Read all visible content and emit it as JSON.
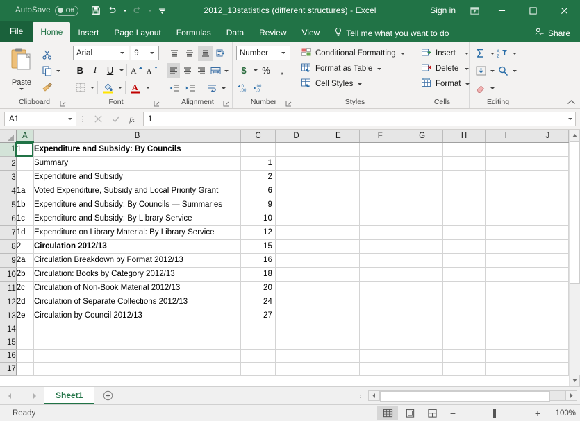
{
  "titlebar": {
    "autosave_label": "AutoSave",
    "autosave_state": "Off",
    "save_icon": "save-icon",
    "undo_icon": "undo-icon",
    "redo_icon": "redo-icon",
    "customize_icon": "customize-quick-access-toolbar-icon",
    "document_title": "2012_13statistics (different structures)  -  Excel",
    "signin_label": "Sign in",
    "ribbon_display_icon": "ribbon-display-options-icon",
    "minimize_icon": "minimize-icon",
    "maximize_icon": "maximize-icon",
    "close_icon": "close-icon"
  },
  "ribbon_tabs": {
    "file": "File",
    "items": [
      {
        "label": "Home",
        "active": true
      },
      {
        "label": "Insert",
        "active": false
      },
      {
        "label": "Page Layout",
        "active": false
      },
      {
        "label": "Formulas",
        "active": false
      },
      {
        "label": "Data",
        "active": false
      },
      {
        "label": "Review",
        "active": false
      },
      {
        "label": "View",
        "active": false
      }
    ],
    "tellme": "Tell me what you want to do",
    "tellme_icon": "lightbulb-icon",
    "share": "Share",
    "share_icon": "share-person-icon"
  },
  "ribbon": {
    "clipboard": {
      "group_label": "Clipboard",
      "paste_label": "Paste",
      "paste_icon": "paste-clipboard-icon",
      "cut_icon": "scissors-icon",
      "copy_icon": "copy-icon",
      "format_painter_icon": "format-painter-icon"
    },
    "font": {
      "group_label": "Font",
      "font_name": "Arial",
      "font_size": "9",
      "bold_label": "B",
      "italic_label": "I",
      "underline_label": "U",
      "grow_font_icon": "increase-font-size-icon",
      "shrink_font_icon": "decrease-font-size-icon",
      "borders_icon": "borders-icon",
      "fill_color_icon": "fill-color-icon",
      "font_color_icon": "font-color-icon"
    },
    "alignment": {
      "group_label": "Alignment",
      "align_top_icon": "align-top-icon",
      "align_middle_icon": "align-middle-icon",
      "align_bottom_icon": "align-bottom-icon",
      "orientation_icon": "text-orientation-icon",
      "align_left_icon": "align-left-icon",
      "align_center_icon": "align-center-icon",
      "align_right_icon": "align-right-icon",
      "wrap_text_icon": "wrap-text-icon",
      "decrease_indent_icon": "decrease-indent-icon",
      "increase_indent_icon": "increase-indent-icon",
      "merge_cells_icon": "merge-and-center-icon"
    },
    "number": {
      "group_label": "Number",
      "format_value": "Number",
      "currency_label": "$",
      "percent_label": "%",
      "comma_label": ",",
      "increase_decimal_icon": "increase-decimal-icon",
      "decrease_decimal_icon": "decrease-decimal-icon"
    },
    "styles": {
      "group_label": "Styles",
      "conditional_formatting": "Conditional Formatting",
      "format_as_table": "Format as Table",
      "cell_styles": "Cell Styles",
      "conditional_formatting_icon": "conditional-formatting-icon",
      "format_as_table_icon": "format-as-table-icon",
      "cell_styles_icon": "cell-styles-icon"
    },
    "cells": {
      "group_label": "Cells",
      "insert": "Insert",
      "delete": "Delete",
      "format": "Format",
      "insert_icon": "insert-cells-icon",
      "delete_icon": "delete-cells-icon",
      "format_icon": "format-cells-icon"
    },
    "editing": {
      "group_label": "Editing",
      "autosum_icon": "autosum-sigma-icon",
      "fill_icon": "fill-down-icon",
      "clear_icon": "clear-eraser-icon",
      "sort_filter_icon": "sort-and-filter-icon",
      "find_select_icon": "find-and-select-magnifier-icon"
    },
    "collapse_icon": "collapse-ribbon-chevron-icon"
  },
  "formulabar": {
    "name_box": "A1",
    "cancel_icon": "cancel-x-icon",
    "enter_icon": "enter-check-icon",
    "insert_function_icon": "fx-insert-function-icon",
    "formula_value": "1",
    "expand_icon": "expand-formula-bar-icon"
  },
  "grid": {
    "columns": [
      "A",
      "B",
      "C",
      "D",
      "E",
      "F",
      "G",
      "H",
      "I",
      "J"
    ],
    "selected_cell": "A1",
    "selected_column": "A",
    "selected_row": 1,
    "rows": [
      {
        "n": "1",
        "a": "1",
        "b": "Expenditure and Subsidy: By Councils",
        "c": "",
        "bold": true
      },
      {
        "n": "2",
        "a": "",
        "b": "Summary",
        "c": "1",
        "bold": false
      },
      {
        "n": "3",
        "a": "",
        "b": "Expenditure and Subsidy",
        "c": "2",
        "bold": false
      },
      {
        "n": "4",
        "a": "1a",
        "b": "Voted Expenditure, Subsidy and Local Priority Grant",
        "c": "6",
        "bold": false
      },
      {
        "n": "5",
        "a": "1b",
        "b": "Expenditure and Subsidy: By Councils — Summaries",
        "c": "9",
        "bold": false
      },
      {
        "n": "6",
        "a": "1c",
        "b": "Expenditure and Subsidy: By Library Service",
        "c": "10",
        "bold": false
      },
      {
        "n": "7",
        "a": "1d",
        "b": "Expenditure on Library Material: By Library Service",
        "c": "12",
        "bold": false
      },
      {
        "n": "8",
        "a": "2",
        "b": "Circulation 2012/13",
        "c": "15",
        "bold": true
      },
      {
        "n": "9",
        "a": "2a",
        "b": "Circulation Breakdown by Format 2012/13",
        "c": "16",
        "bold": false
      },
      {
        "n": "10",
        "a": "2b",
        "b": "Circulation: Books by Category 2012/13",
        "c": "18",
        "bold": false
      },
      {
        "n": "11",
        "a": "2c",
        "b": "Circulation of Non-Book Material 2012/13",
        "c": "20",
        "bold": false
      },
      {
        "n": "12",
        "a": "2d",
        "b": "Circulation of Separate Collections 2012/13",
        "c": "24",
        "bold": false
      },
      {
        "n": "13",
        "a": "2e",
        "b": "Circulation by Council 2012/13",
        "c": "27",
        "bold": false
      },
      {
        "n": "14",
        "a": "",
        "b": "",
        "c": "",
        "bold": false
      },
      {
        "n": "15",
        "a": "",
        "b": "",
        "c": "",
        "bold": false
      },
      {
        "n": "16",
        "a": "",
        "b": "",
        "c": "",
        "bold": false
      },
      {
        "n": "17",
        "a": "",
        "b": "",
        "c": "",
        "bold": false
      }
    ]
  },
  "tabbar": {
    "prev_icon": "previous-sheet-icon",
    "next_icon": "next-sheet-icon",
    "sheet_name": "Sheet1",
    "add_sheet_icon": "add-sheet-plus-icon"
  },
  "statusbar": {
    "status": "Ready",
    "normal_view_icon": "normal-view-icon",
    "page_layout_icon": "page-layout-view-icon",
    "page_break_icon": "page-break-preview-icon",
    "zoom_out_label": "−",
    "zoom_in_label": "+",
    "zoom_level": "100%"
  }
}
